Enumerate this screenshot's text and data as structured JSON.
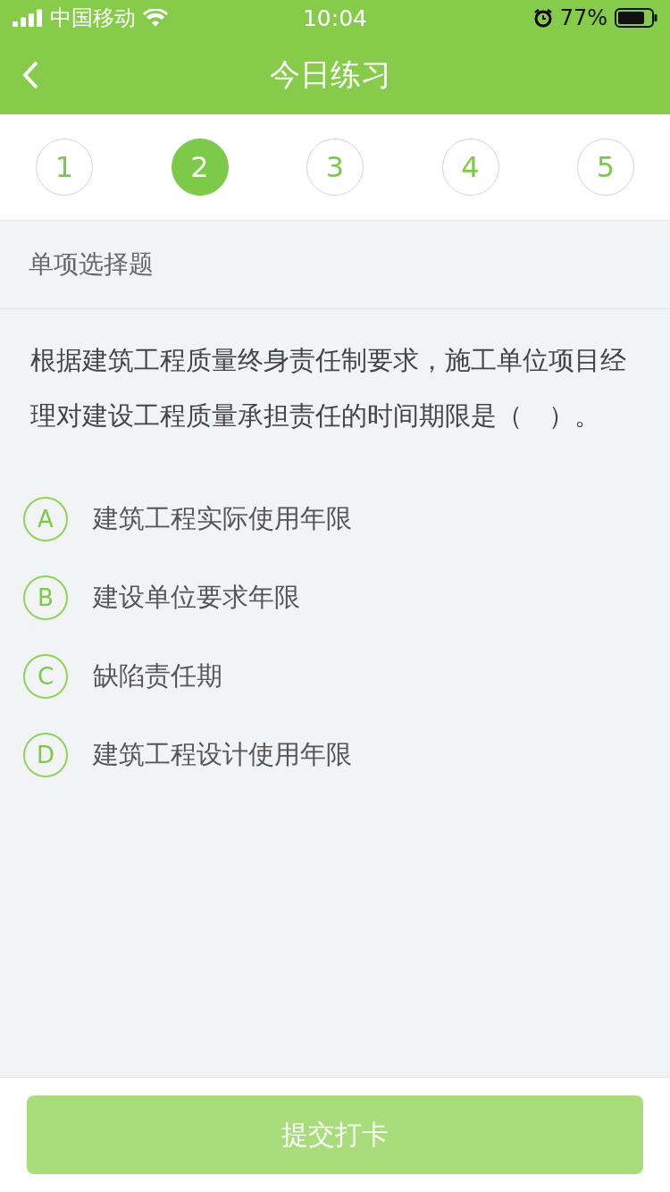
{
  "status_bar": {
    "carrier": "中国移动",
    "time": "10:04",
    "battery": "77%"
  },
  "nav": {
    "title": "今日练习"
  },
  "steps": [
    {
      "label": "1",
      "selected": false
    },
    {
      "label": "2",
      "selected": true
    },
    {
      "label": "3",
      "selected": false
    },
    {
      "label": "4",
      "selected": false
    },
    {
      "label": "5",
      "selected": false
    }
  ],
  "section": {
    "title": "单项选择题"
  },
  "question": {
    "text": "根据建筑工程质量终身责任制要求，施工单位项目经理对建设工程质量承担责任的时间期限是（　）。"
  },
  "options": [
    {
      "letter": "A",
      "text": "建筑工程实际使用年限",
      "selected": false
    },
    {
      "letter": "B",
      "text": "建设单位要求年限",
      "selected": false
    },
    {
      "letter": "C",
      "text": "缺陷责任期",
      "selected": false
    },
    {
      "letter": "D",
      "text": "建筑工程设计使用年限",
      "selected": false
    }
  ],
  "submit": {
    "label": "提交打卡",
    "disabled": true
  }
}
